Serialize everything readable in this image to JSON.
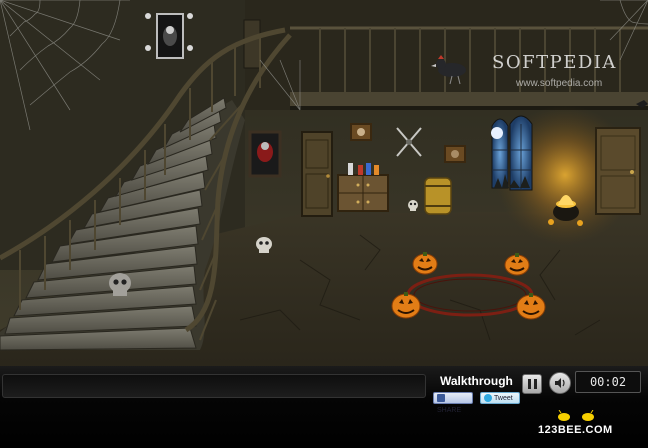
{
  "game": {
    "hud": {
      "walkthrough_label": "Walkthrough",
      "timer": "00:02",
      "share_label": "SHARE",
      "tweet_label": "Tweet",
      "brand": "123BEE.COM"
    },
    "watermark": {
      "name": "SOFTPEDIA",
      "url": "www.softpedia.com"
    },
    "colors": {
      "fb": "#3b5998",
      "tw": "#2fa9e0",
      "candle_glow": "#f3a320"
    },
    "icons": [
      "pause-icon",
      "speaker-icon",
      "facebook-icon",
      "twitter-icon",
      "bee-icon"
    ]
  }
}
